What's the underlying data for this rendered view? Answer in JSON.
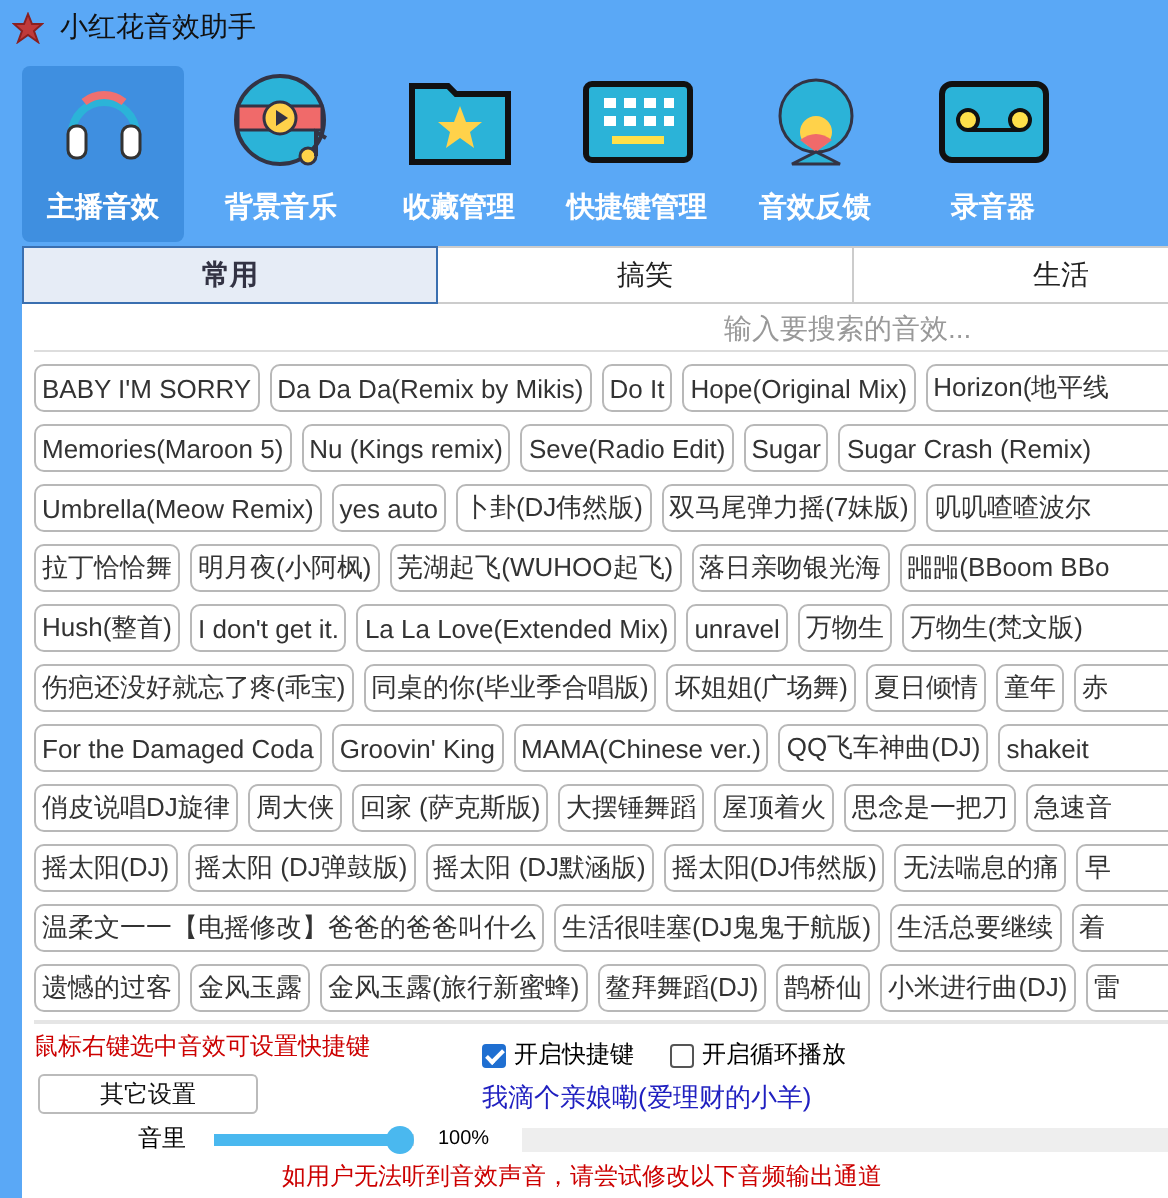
{
  "window": {
    "title": "小红花音效助手"
  },
  "toolbar": [
    {
      "label": "主播音效",
      "selected": true
    },
    {
      "label": "背景音乐",
      "selected": false
    },
    {
      "label": "收藏管理",
      "selected": false
    },
    {
      "label": "快捷键管理",
      "selected": false
    },
    {
      "label": "音效反馈",
      "selected": false
    },
    {
      "label": "录音器",
      "selected": false
    }
  ],
  "tabs": [
    {
      "label": "常用",
      "selected": true
    },
    {
      "label": "搞笑",
      "selected": false
    },
    {
      "label": "生活",
      "selected": false
    }
  ],
  "search": {
    "placeholder": "输入要搜索的音效..."
  },
  "sound_rows": [
    [
      "BABY I'M SORRY",
      "Da Da Da(Remix by Mikis)",
      "Do It",
      "Hope(Original Mix)",
      "Horizon(地平线"
    ],
    [
      "Memories(Maroon 5)",
      "Nu (Kings remix)",
      "Seve(Radio Edit)",
      "Sugar",
      "Sugar Crash (Remix)"
    ],
    [
      "Umbrella(Meow Remix)",
      "yes auto",
      "卜卦(DJ伟然版)",
      "双马尾弹力摇(7妹版)",
      "叽叽喳喳波尔"
    ],
    [
      "拉丁恰恰舞",
      "明月夜(小阿枫)",
      "芜湖起飞(WUHOO起飞)",
      "落日亲吻银光海",
      "嘂嘂(BBoom BBo"
    ],
    [
      "Hush(整首)",
      "I don't get it.",
      "La La Love(Extended Mix)",
      "unravel",
      "万物生",
      "万物生(梵文版)"
    ],
    [
      "伤疤还没好就忘了疼(乖宝)",
      "同桌的你(毕业季合唱版)",
      "坏姐姐(广场舞)",
      "夏日倾情",
      "童年",
      "赤"
    ],
    [
      "For the Damaged Coda",
      "Groovin' King",
      "MAMA(Chinese ver.)",
      "QQ飞车神曲(DJ)",
      "shakeit"
    ],
    [
      "俏皮说唱DJ旋律",
      "周大侠",
      "回家 (萨克斯版)",
      "大摆锤舞蹈",
      "屋顶着火",
      "思念是一把刀",
      "急速音"
    ],
    [
      "摇太阳(DJ)",
      "摇太阳 (DJ弹鼓版)",
      "摇太阳 (DJ默涵版)",
      "摇太阳(DJ伟然版)",
      "无法喘息的痛",
      "早"
    ],
    [
      "温柔文一一【电摇修改】爸爸的爸爸叫什么",
      "生活很哇塞(DJ鬼鬼于航版)",
      "生活总要继续",
      "着"
    ],
    [
      "遗憾的过客",
      "金风玉露",
      "金风玉露(旅行新蜜蜂)",
      "鳌拜舞蹈(DJ)",
      "鹊桥仙",
      "小米进行曲(DJ)",
      "雷"
    ]
  ],
  "hint": "鼠标右键选中音效可设置快捷键",
  "options": [
    {
      "label": "开启快捷键",
      "checked": true
    },
    {
      "label": "开启循环播放",
      "checked": false
    }
  ],
  "settings_button": "其它设置",
  "now_playing": "我滴个亲娘嘞(爱理财的小羊)",
  "volume": {
    "label": "音里",
    "level": 1.0,
    "reading": "100%"
  },
  "output_hint": "如用户无法听到音效声音，请尝试修改以下音频输出通道"
}
